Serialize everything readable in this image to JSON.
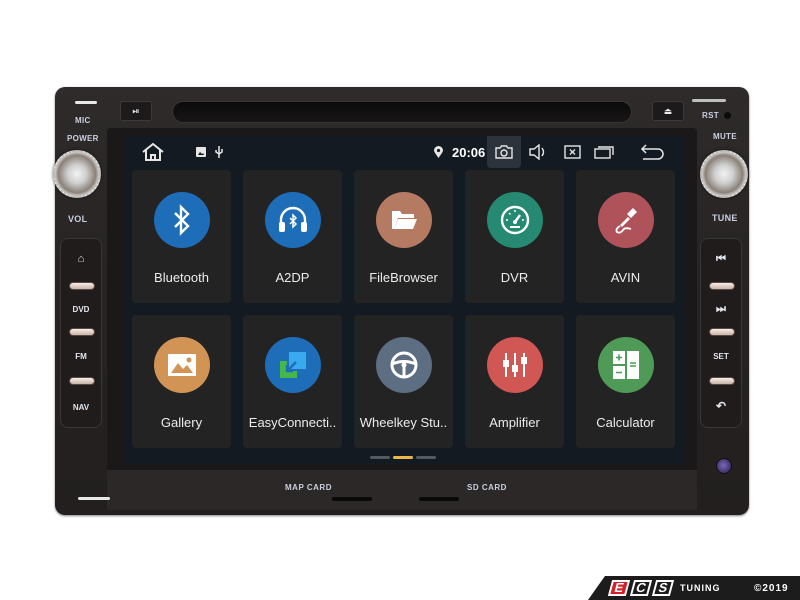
{
  "hardware": {
    "top_left_labels": {
      "mic": "MIC",
      "power": "POWER",
      "vol": "VOL"
    },
    "top_right_labels": {
      "rst": "RST",
      "mute": "MUTE",
      "tune": "TUNE"
    },
    "play_pause_icon": "⏯",
    "eject_icon": "⏏",
    "left_buttons": [
      {
        "label": "⌂",
        "name": "home"
      },
      {
        "label": "DVD",
        "name": "dvd"
      },
      {
        "label": "FM",
        "name": "fm"
      },
      {
        "label": "NAV",
        "name": "nav"
      }
    ],
    "right_buttons": [
      {
        "label": "⏮",
        "name": "previous"
      },
      {
        "label": "⏭",
        "name": "next"
      },
      {
        "label": "SET",
        "name": "set"
      },
      {
        "label": "↶",
        "name": "back"
      }
    ],
    "card_labels": {
      "map_card": "MAP CARD",
      "sd_card": "SD CARD"
    }
  },
  "statusbar": {
    "home_icon": "home-icon",
    "notification_icons": [
      "image-icon",
      "usb-icon"
    ],
    "location_icon": "location-pin-icon",
    "time": "20:06",
    "actions": [
      "screenshot-camera-icon",
      "volume-icon",
      "close-app-icon",
      "recent-apps-icon",
      "back-icon"
    ]
  },
  "apps": [
    {
      "label": "Bluetooth",
      "icon": "bluetooth-icon",
      "color": "#1e6db8"
    },
    {
      "label": "A2DP",
      "icon": "bluetooth-headphones-icon",
      "color": "#1e6db8"
    },
    {
      "label": "FileBrowser",
      "icon": "folder-icon",
      "color": "#b57a62"
    },
    {
      "label": "DVR",
      "icon": "speedometer-icon",
      "color": "#268a72"
    },
    {
      "label": "AVIN",
      "icon": "audio-jack-icon",
      "color": "#b0525a"
    },
    {
      "label": "Gallery",
      "icon": "picture-icon",
      "color": "#d19455"
    },
    {
      "label": "EasyConnecti..",
      "icon": "easyconnection-icon",
      "color": "#1e6db8"
    },
    {
      "label": "Wheelkey Stu..",
      "icon": "steering-wheel-icon",
      "color": "#5d6d82"
    },
    {
      "label": "Amplifier",
      "icon": "equalizer-icon",
      "color": "#d05753"
    },
    {
      "label": "Calculator",
      "icon": "calculator-icon",
      "color": "#4f9a56"
    }
  ],
  "page_indicator": {
    "pages": 3,
    "active": 1,
    "active_color": "#e9b84a"
  },
  "watermark": {
    "brand_letters": [
      "E",
      "C",
      "S"
    ],
    "brand_suffix": "TUNING",
    "copyright": "©2019"
  }
}
